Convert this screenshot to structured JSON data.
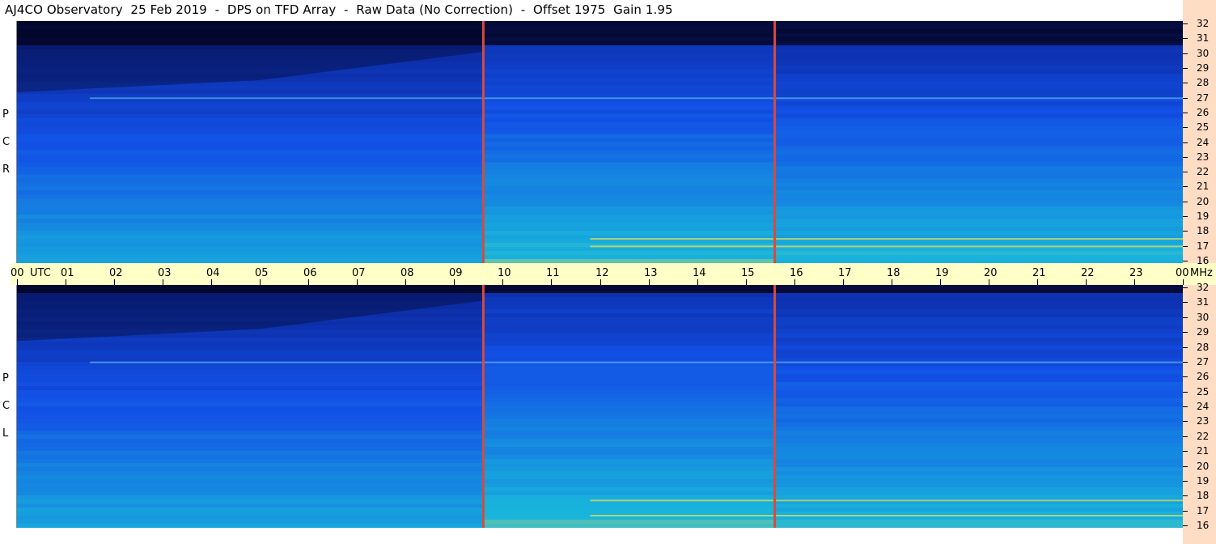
{
  "title": "AJ4CO Observatory  25 Feb 2019  -  DPS on TFD Array  -  Raw Data (No Correction)  -  Offset 1975  Gain 1.95",
  "top_panel_polarization": [
    "R",
    "C",
    "P"
  ],
  "bottom_panel_polarization": [
    "L",
    "C",
    "P"
  ],
  "time_axis": {
    "unit_label": "UTC",
    "end_unit": "MHz",
    "ticks": [
      "00",
      "01",
      "02",
      "03",
      "04",
      "05",
      "06",
      "07",
      "08",
      "09",
      "10",
      "11",
      "12",
      "13",
      "14",
      "15",
      "16",
      "17",
      "18",
      "19",
      "20",
      "21",
      "22",
      "23",
      "00"
    ]
  },
  "colors": {
    "background_dark": "#020212",
    "low": "#0a1e8c",
    "mid": "#1250e6",
    "high": "#18b4dc",
    "hot": "#f0e050",
    "axis_strip": "#ffdcc4",
    "time_strip": "#ffffc8",
    "interference_line": "#d84a3a"
  },
  "chart_data": {
    "type": "heatmap",
    "title": "AJ4CO Observatory  25 Feb 2019  -  DPS on TFD Array  -  Raw Data (No Correction)  -  Offset 1975  Gain 1.95",
    "x_unit": "UTC hour",
    "y_unit": "MHz",
    "xlim": [
      0,
      24
    ],
    "ylim": [
      16,
      32
    ],
    "y_ticks": [
      32,
      31,
      30,
      29,
      28,
      27,
      26,
      25,
      24,
      23,
      22,
      21,
      20,
      19,
      18,
      17,
      16
    ],
    "panels": [
      {
        "polarization": "RCP",
        "interference_times_utc": [
          9.6,
          15.6
        ],
        "segment_boundaries_utc": [
          9.6,
          15.6
        ],
        "bright_bands_mhz": [
          17.1,
          17.6,
          26.9
        ],
        "cutoff_top_mhz": 30.5
      },
      {
        "polarization": "LCP",
        "interference_times_utc": [
          9.6,
          15.6
        ],
        "segment_boundaries_utc": [
          9.6,
          15.6
        ],
        "bright_bands_mhz": [
          16.8,
          17.8,
          26.9
        ],
        "cutoff_top_mhz": 31.5
      }
    ]
  }
}
